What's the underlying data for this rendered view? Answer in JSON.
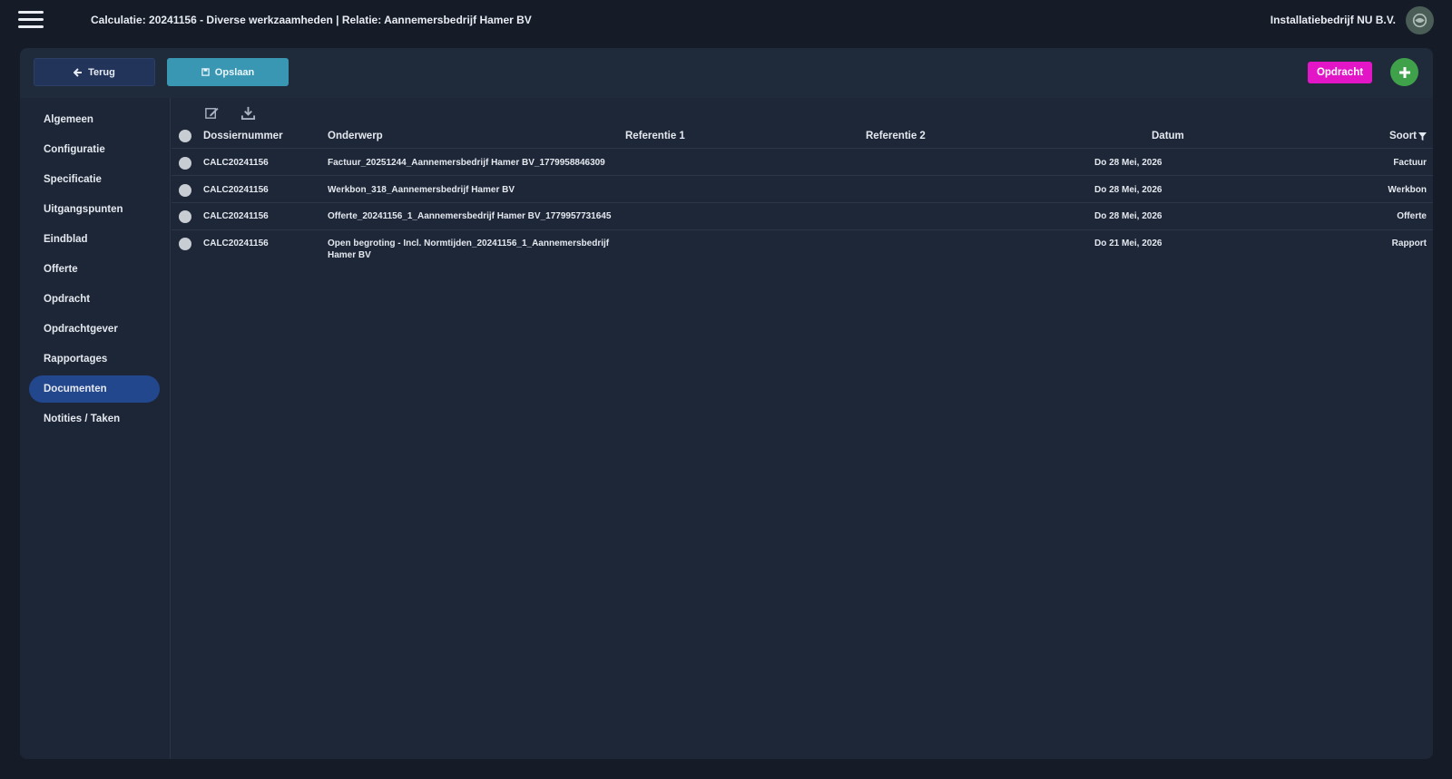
{
  "header": {
    "title": "Calculatie: 20241156 - Diverse werkzaamheden | Relatie: Aannemersbedrijf Hamer BV",
    "company": "Installatiebedrijf NU B.V."
  },
  "toolbar": {
    "back_label": "Terug",
    "save_label": "Opslaan",
    "opdracht_label": "Opdracht"
  },
  "sidebar": {
    "items": [
      {
        "label": "Algemeen"
      },
      {
        "label": "Configuratie"
      },
      {
        "label": "Specificatie"
      },
      {
        "label": "Uitgangspunten"
      },
      {
        "label": "Eindblad"
      },
      {
        "label": "Offerte"
      },
      {
        "label": "Opdracht"
      },
      {
        "label": "Opdrachtgever"
      },
      {
        "label": "Rapportages"
      },
      {
        "label": "Documenten",
        "active": true
      },
      {
        "label": "Notities / Taken"
      }
    ]
  },
  "table": {
    "columns": {
      "dossiernummer": "Dossiernummer",
      "onderwerp": "Onderwerp",
      "referentie1": "Referentie 1",
      "referentie2": "Referentie 2",
      "datum": "Datum",
      "soort": "Soort"
    },
    "rows": [
      {
        "dossiernummer": "CALC20241156",
        "onderwerp": "Factuur_20251244_Aannemersbedrijf Hamer BV_1779958846309",
        "referentie1": "",
        "referentie2": "",
        "datum": "Do 28 Mei, 2026",
        "soort": "Factuur"
      },
      {
        "dossiernummer": "CALC20241156",
        "onderwerp": "Werkbon_318_Aannemersbedrijf Hamer BV",
        "referentie1": "",
        "referentie2": "",
        "datum": "Do 28 Mei, 2026",
        "soort": "Werkbon"
      },
      {
        "dossiernummer": "CALC20241156",
        "onderwerp": "Offerte_20241156_1_Aannemersbedrijf Hamer BV_1779957731645",
        "referentie1": "",
        "referentie2": "",
        "datum": "Do 28 Mei, 2026",
        "soort": "Offerte"
      },
      {
        "dossiernummer": "CALC20241156",
        "onderwerp": "Open begroting - Incl. Normtijden_20241156_1_Aannemersbedrijf Hamer BV",
        "referentie1": "",
        "referentie2": "",
        "datum": "Do 21 Mei, 2026",
        "soort": "Rapport"
      }
    ]
  },
  "icons": {
    "menu": "hamburger-icon",
    "avatar": "avatar-icon",
    "back": "arrow-left-icon",
    "save": "save-icon",
    "add": "plus-icon",
    "edit": "edit-icon",
    "download": "download-icon",
    "filter": "filter-icon"
  },
  "colors": {
    "background": "#151c28",
    "panel": "#1d2636",
    "save": "#3a97b3",
    "back": "#22345a",
    "opdracht": "#e316c7",
    "add": "#3fa24b",
    "active_nav": "#23478d"
  }
}
